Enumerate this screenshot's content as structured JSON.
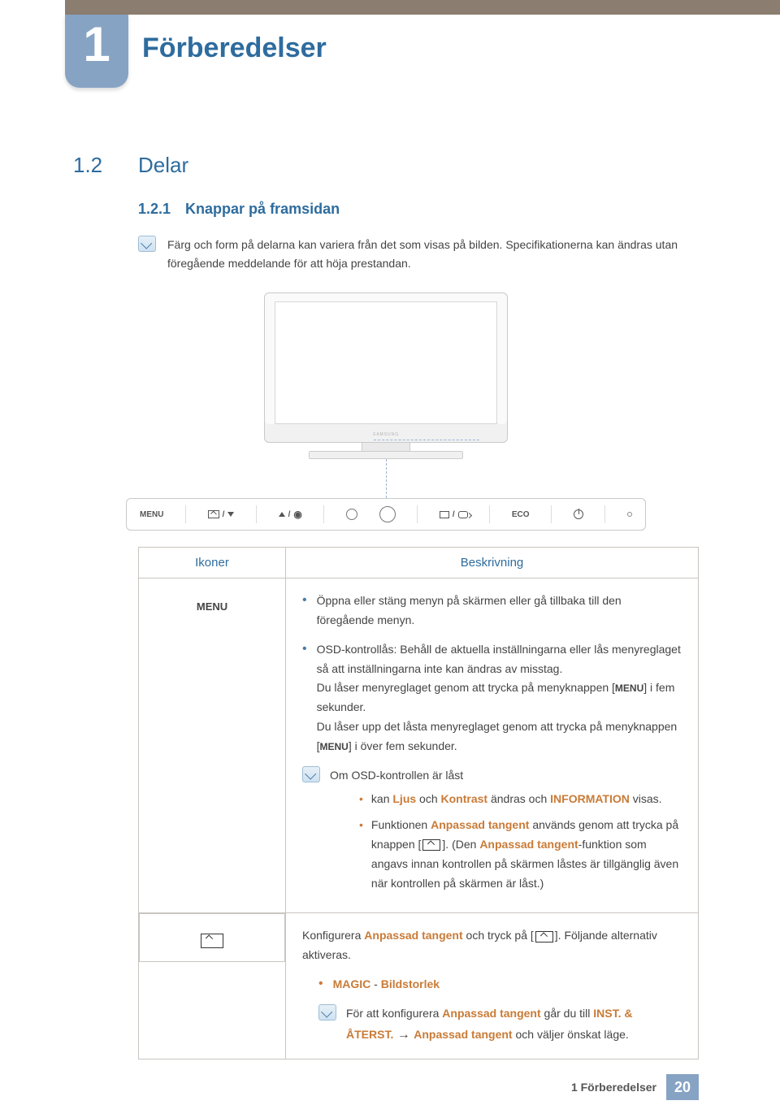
{
  "chapter": {
    "number": "1",
    "title": "Förberedelser"
  },
  "section": {
    "number": "1.2",
    "title": "Delar"
  },
  "subsection": {
    "number": "1.2.1",
    "title": "Knappar på framsidan"
  },
  "intro_note": "Färg och form på delarna kan variera från det som visas på bilden. Specifikationerna kan ändras utan föregående meddelande för att höja prestandan.",
  "diagram": {
    "brand": "SAMSUNG",
    "buttons": {
      "menu": "MENU",
      "eco": "ECO"
    }
  },
  "table": {
    "head": {
      "icons": "Ikoner",
      "desc": "Beskrivning"
    },
    "row1": {
      "icon_label": "MENU",
      "b1": "Öppna eller stäng menyn på skärmen eller gå tillbaka till den föregående menyn.",
      "b2_p1": "OSD-kontrollås: Behåll de aktuella inställningarna eller lås menyreglaget så att inställningarna inte kan ändras av misstag.",
      "b2_p2a": "Du låser menyreglaget genom att trycka på menyknappen [",
      "b2_p2_kw": "MENU",
      "b2_p2b": "] i fem sekunder.",
      "b2_p3a": "Du låser upp det låsta menyreglaget genom att trycka på menyknappen [",
      "b2_p3_kw": "MENU",
      "b2_p3b": "] i över fem sekunder.",
      "note_title": "Om OSD-kontrollen är låst",
      "sb1_a": "kan ",
      "sb1_hl1": "Ljus",
      "sb1_b": " och ",
      "sb1_hl2": "Kontrast",
      "sb1_c": " ändras och ",
      "sb1_hl3": "INFORMATION",
      "sb1_d": " visas.",
      "sb2_a": "Funktionen ",
      "sb2_hl1": "Anpassad tangent",
      "sb2_b": " används genom att trycka på knappen [",
      "sb2_c": "]. (Den ",
      "sb2_hl2": "Anpassad tangent",
      "sb2_d": "-funktion som angavs innan kontrollen på skärmen låstes är tillgänglig även när kontrollen på skärmen är låst.)"
    },
    "row2": {
      "p1a": "Konfigurera ",
      "p1_hl1": "Anpassad tangent",
      "p1b": " och tryck på [",
      "p1c": "]. Följande alternativ aktiveras.",
      "opt_hl1": "MAGIC",
      "opt_sep": " - ",
      "opt_hl2": "Bildstorlek",
      "note_a": "För att konfigurera ",
      "note_hl1": "Anpassad tangent",
      "note_b": " går du till ",
      "note_hl2": "INST. & ÅTERST.",
      "note_arrow": " → ",
      "note_hl3": "Anpassad tangent",
      "note_c": " och väljer önskat läge."
    }
  },
  "footer": {
    "text": "1 Förberedelser",
    "page": "20"
  }
}
